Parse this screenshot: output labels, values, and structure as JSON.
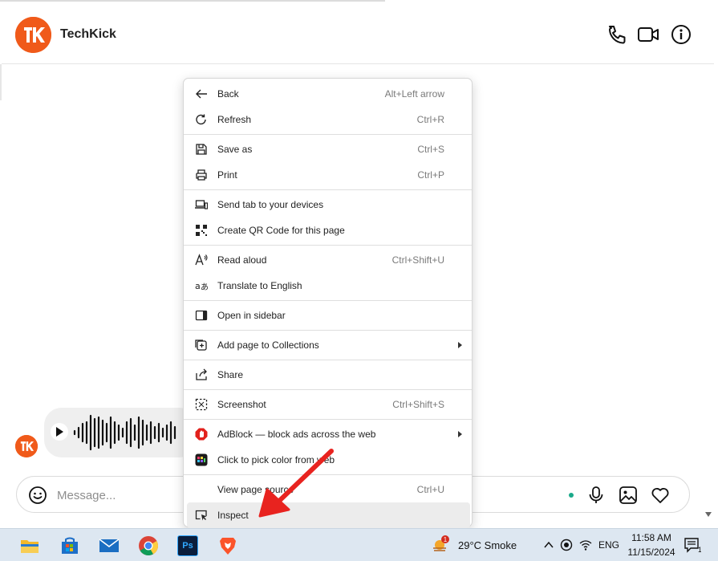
{
  "chat": {
    "title": "TechKick",
    "avatar_initials": "TK",
    "brand_color": "#f05a1a"
  },
  "composer": {
    "placeholder": "Message..."
  },
  "context_menu": {
    "items": [
      {
        "label": "Back",
        "shortcut": "Alt+Left arrow",
        "icon": "back-arrow-icon"
      },
      {
        "label": "Refresh",
        "shortcut": "Ctrl+R",
        "icon": "refresh-icon"
      },
      {
        "label": "Save as",
        "shortcut": "Ctrl+S",
        "icon": "save-icon"
      },
      {
        "label": "Print",
        "shortcut": "Ctrl+P",
        "icon": "printer-icon"
      },
      {
        "label": "Send tab to your devices",
        "shortcut": "",
        "icon": "devices-icon"
      },
      {
        "label": "Create QR Code for this page",
        "shortcut": "",
        "icon": "qr-code-icon"
      },
      {
        "label": "Read aloud",
        "shortcut": "Ctrl+Shift+U",
        "icon": "read-aloud-icon"
      },
      {
        "label": "Translate to English",
        "shortcut": "",
        "icon": "translate-icon"
      },
      {
        "label": "Open in sidebar",
        "shortcut": "",
        "icon": "sidebar-icon"
      },
      {
        "label": "Add page to Collections",
        "shortcut": "",
        "icon": "collections-icon",
        "submenu": true
      },
      {
        "label": "Share",
        "shortcut": "",
        "icon": "share-icon"
      },
      {
        "label": "Screenshot",
        "shortcut": "Ctrl+Shift+S",
        "icon": "screenshot-icon"
      },
      {
        "label": "AdBlock — block ads across the web",
        "shortcut": "",
        "icon": "adblock-icon",
        "submenu": true
      },
      {
        "label": "Click to pick color from web",
        "shortcut": "",
        "icon": "color-picker-icon"
      },
      {
        "label": "View page source",
        "shortcut": "Ctrl+U",
        "icon": ""
      },
      {
        "label": "Inspect",
        "shortcut": "",
        "icon": "inspect-icon",
        "highlighted": true
      }
    ]
  },
  "taskbar": {
    "apps": [
      "file-explorer-icon",
      "microsoft-store-icon",
      "mail-icon",
      "chrome-icon",
      "photoshop-icon",
      "brave-icon"
    ],
    "weather_badge": "1",
    "weather_text": "29°C  Smoke",
    "language": "ENG",
    "time": "11:58 AM",
    "date": "11/15/2024",
    "notification_count": "1",
    "photoshop_label": "Ps"
  },
  "colors": {
    "annotation_arrow": "#e8231f",
    "taskbar_bg": "#dde7f1",
    "menu_hover": "#ececec",
    "online_dot": "#1aa98a"
  }
}
